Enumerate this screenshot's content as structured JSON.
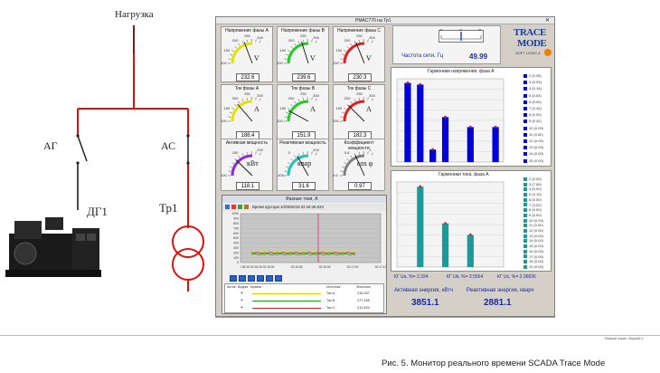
{
  "window": {
    "title": "PMAC770 на Тр1",
    "status_bar": "Текущий экран: Экран#1.1"
  },
  "schematic": {
    "load_label": "Нагрузка",
    "breaker_ag": "АГ",
    "breaker_ac": "АС",
    "generator_label": "ДГ1",
    "transformer_label": "Тр1"
  },
  "gauges": {
    "voltage_a": {
      "title": "Напряжение фазы А",
      "value": "232.6",
      "unit": "V",
      "scale": [
        "100",
        "150",
        "200",
        "250",
        "300"
      ],
      "color": "#e4e400",
      "level": 0.63
    },
    "voltage_b": {
      "title": "Напряжение фазы В",
      "value": "239.6",
      "unit": "V",
      "scale": [
        "100",
        "150",
        "200",
        "250",
        "300"
      ],
      "color": "#22cc22",
      "level": 0.66
    },
    "voltage_c": {
      "title": "Напряжение фазы С",
      "value": "230.3",
      "unit": "V",
      "scale": [
        "100",
        "150",
        "200",
        "250",
        "300"
      ],
      "color": "#e02020",
      "level": 0.62
    },
    "current_a": {
      "title": "Ток фазы А",
      "value": "188.4",
      "unit": "A",
      "scale": [
        "100",
        "150",
        "200",
        "250",
        "300"
      ],
      "color": "#e4e400",
      "level": 0.45
    },
    "current_b": {
      "title": "Ток фазы В",
      "value": "151.9",
      "unit": "A",
      "scale": [
        "100",
        "150",
        "200",
        "250",
        "300"
      ],
      "color": "#22cc22",
      "level": 0.26
    },
    "current_c": {
      "title": "Ток фазы С",
      "value": "182.3",
      "unit": "A",
      "scale": [
        "100",
        "150",
        "200",
        "250",
        "300"
      ],
      "color": "#e02020",
      "level": 0.41
    },
    "active_power": {
      "title": "Активная мощность",
      "value": "118.1",
      "unit": "кВт",
      "scale": [
        "100",
        "150",
        "200"
      ],
      "color": "#8a2be2",
      "level": 0.4
    },
    "reactive_power": {
      "title": "Реактивная мощность",
      "value": "31.6",
      "unit": "квар",
      "scale": [
        "-400",
        "0",
        "400"
      ],
      "color": "#20c0c0",
      "level": 0.55
    },
    "power_factor": {
      "title": "Коэффициент мощности",
      "value": "0.97",
      "unit": "cos φ",
      "scale": [
        "0.6",
        "0.8",
        "1"
      ],
      "color": "#808080",
      "level": 0.6
    }
  },
  "frequency": {
    "label": "Частота сети, Гц",
    "value": "49.99",
    "scale": [
      "45",
      "50",
      "55"
    ]
  },
  "logo": {
    "line1": "TRACE",
    "line2": "MODE",
    "line3": "SOFT LOGIC 6"
  },
  "harmonics_voltage": {
    "title": "Гармоники напряжения, фаза А",
    "legend": [
      "2 (0.95)",
      "3 (0.93)",
      "4 (0.15)",
      "5 (0.54)",
      "6 (0.00)",
      "7 (0.42)",
      "8 (0.00)",
      "9 (0.42)",
      "10 (0.00)",
      "11 (0.00)",
      "12 (0.00)",
      "13 (0.00)",
      "14 (0.00)",
      "15 (0.00)"
    ]
  },
  "harmonics_current": {
    "title": "Гармоники тока, фаза А",
    "legend": [
      "2 (0.00)",
      "3 (7.56)",
      "4 (0.00)",
      "5 (4.10)",
      "6 (0.00)",
      "7 (3.02)",
      "8 (0.00)",
      "9 (0.00)",
      "10 (0.00)",
      "11 (0.00)",
      "12 (0.00)",
      "13 (0.00)",
      "14 (0.00)",
      "15 (0.00)",
      "16 (0.00)",
      "17 (0.00)",
      "18 (0.00)",
      "19 (0.00)"
    ]
  },
  "thd": {
    "u_label": "КГ Ua, %=",
    "u_value": "2.324",
    "ub_label": "КГ Ub, %=",
    "ub_value": "2.5564",
    "uc_label": "КГ Uc, %=",
    "uc_value": "2.06836"
  },
  "energy": {
    "active_label": "Активная энергия, кВтч",
    "active_value": "3851.1",
    "reactive_label": "Реактивная энергия, кварч",
    "reactive_value": "2881.1"
  },
  "trend": {
    "title": "Фазные токи, А",
    "time_label": "Время курсора 10/05/2015 02:16:45.534",
    "y_ticks": [
      "1000",
      "900",
      "800",
      "700",
      "600",
      "500",
      "400",
      "300",
      "200",
      "100",
      "0"
    ],
    "x_ticks": [
      "I:05:15 02:16:25",
      "02:16:30",
      "02:16:35",
      "02:16:45",
      "02:17:00",
      "02:17:10"
    ],
    "table_headers": [
      "Актив",
      "Видим",
      "Кривая",
      "Источник",
      "Значение"
    ],
    "rows": [
      {
        "source": "Ток А",
        "value": "215.337",
        "color": "#e0d000"
      },
      {
        "source": "Ток В",
        "value": "177.155",
        "color": "#20a020"
      },
      {
        "source": "Ток С",
        "value": "212.454",
        "color": "#e02020"
      }
    ]
  },
  "chart_data": [
    {
      "type": "bar",
      "title": "Гармоники напряжения, фаза А",
      "categories": [
        "2",
        "3",
        "4",
        "5",
        "6",
        "7",
        "8",
        "9",
        "10",
        "11",
        "12",
        "13",
        "14",
        "15"
      ],
      "series": [
        {
          "values": [
            0.95,
            0.93,
            0.15,
            0.54,
            0.0,
            0.42,
            0.0,
            0.42,
            0.0,
            0.0,
            0.0,
            0.0,
            0.0,
            0.0
          ]
        }
      ],
      "colors": [
        "#0000dd"
      ]
    },
    {
      "type": "bar",
      "title": "Гармоники тока, фаза А",
      "categories": [
        "2",
        "3",
        "4",
        "5",
        "6",
        "7",
        "8",
        "9",
        "10",
        "11",
        "12",
        "13",
        "14",
        "15",
        "16",
        "17",
        "18",
        "19"
      ],
      "series": [
        {
          "values": [
            0.0,
            7.56,
            0.0,
            4.1,
            0.0,
            3.02,
            0.0,
            0.0,
            0.0,
            0.0,
            0.0,
            0.0,
            0.0,
            0.0,
            0.0,
            0.0,
            0.0,
            0.0
          ]
        }
      ],
      "colors": [
        "#1a9a9a"
      ]
    }
  ],
  "caption": "Рис. 5. Монитор реального времени SCADA Trace Mode"
}
